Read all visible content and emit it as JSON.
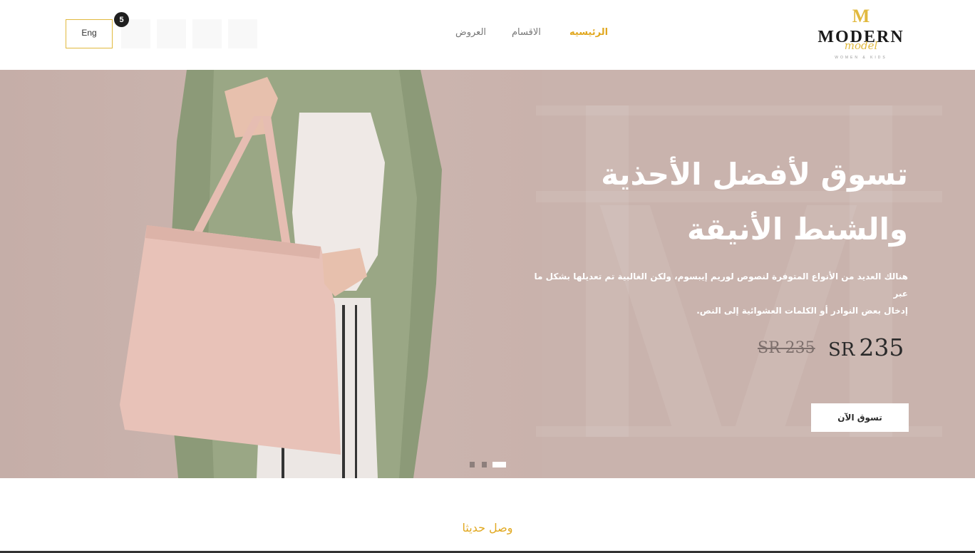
{
  "header": {
    "lang_label": "Eng",
    "cart_count": "5",
    "icons": [
      "heart-icon",
      "user-icon",
      "search-icon",
      "cart-icon"
    ],
    "nav": [
      {
        "label": "الرئيسيه",
        "active": true
      },
      {
        "label": "الاقسام",
        "active": false
      },
      {
        "label": "العروض",
        "active": false
      }
    ],
    "logo": {
      "mark": "M",
      "word": "MODERN",
      "script": "model",
      "sub": "WOMEN & KIDS"
    }
  },
  "hero": {
    "title_line1": "تسوق لأفضل الأحذية",
    "title_line2": "والشنط الأنيقة",
    "description_line1": "هنالك العديد من الأنواع المتوفرة لنصوص لوريم إيبسوم، ولكن الغالبية تم تعديلها بشكل ما عبر",
    "description_line2": "إدخال بعض النوادر أو الكلمات العشوائية إلى النص.",
    "price_old": "SR 235",
    "price_currency": "SR",
    "price_amount": "235",
    "cta_label": "تسوق الآن",
    "slides_total": 3,
    "slide_active": 3
  },
  "section": {
    "title": "وصل حديثا"
  },
  "colors": {
    "accent": "#e1a820",
    "hero_bg": "#c9b3ad",
    "badge": "#1f1f1f"
  }
}
